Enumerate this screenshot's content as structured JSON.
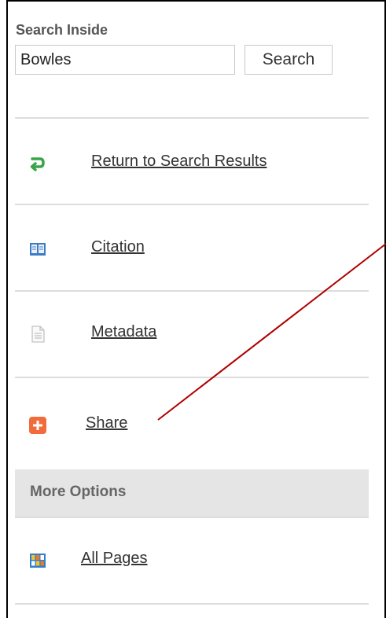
{
  "search": {
    "title": "Search Inside",
    "value": "Bowles",
    "button_label": "Search"
  },
  "items": {
    "return": {
      "label": "Return to Search Results",
      "icon": "return-arrow-icon",
      "color": "#3aa548"
    },
    "citation": {
      "label": "Citation",
      "icon": "book-icon",
      "color": "#3d7bc4"
    },
    "metadata": {
      "label": "Metadata",
      "icon": "document-icon",
      "color": "#cccccc"
    },
    "share": {
      "label": "Share",
      "icon": "plus-icon",
      "color": "#f26b3a"
    }
  },
  "more_options": {
    "title": "More Options",
    "all_pages": {
      "label": "All Pages",
      "icon": "grid-icon",
      "color": "#2f7fcf"
    }
  }
}
